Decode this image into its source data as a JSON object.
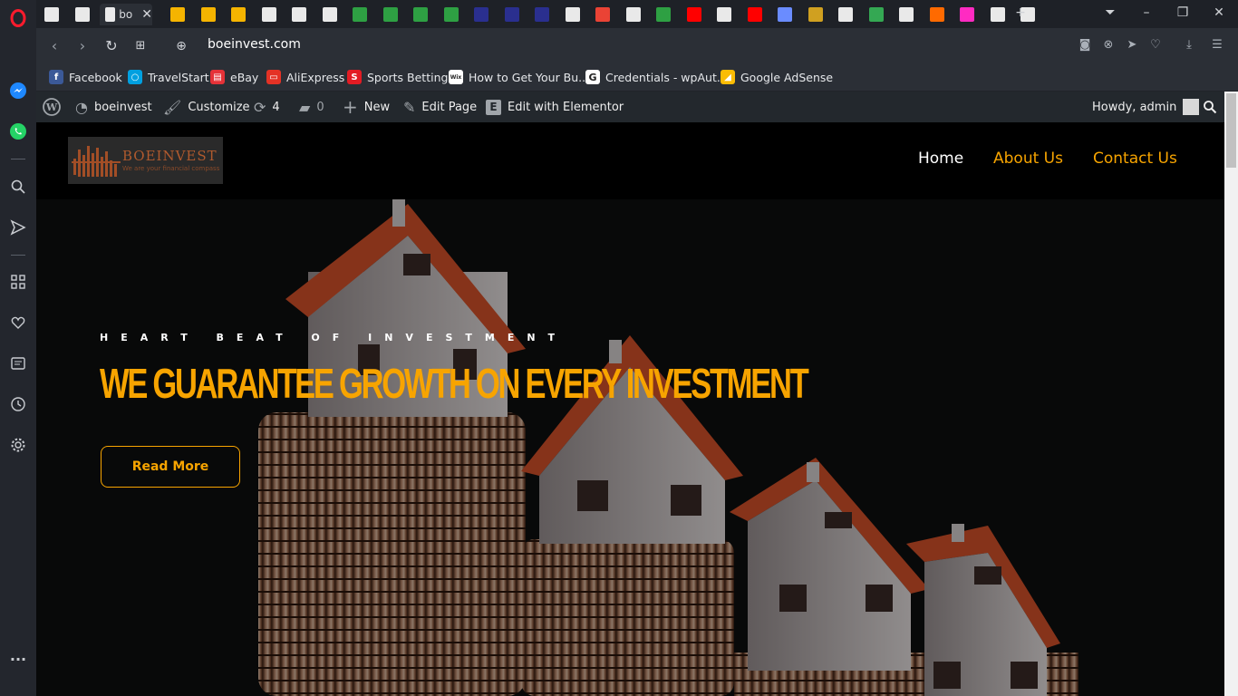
{
  "browser": {
    "active_tab_title": "bo",
    "url": "boeinvest.com",
    "tab_favicon_colors": [
      "#ffffff",
      "#ffffff",
      "#ffffff",
      "#f5b400",
      "#f5b400",
      "#f5b400",
      "#ffffff",
      "#ffffff",
      "#ffffff",
      "#2ea043",
      "#2ea043",
      "#2ea043",
      "#2ea043",
      "#2a2f8f",
      "#2a2f8f",
      "#2a2f8f",
      "#ffffff",
      "#ea4335",
      "#ffffff",
      "#2ea043",
      "#ff0000",
      "#ffffff",
      "#ff0000",
      "#6a8cff",
      "#d0a020",
      "#ffffff",
      "#34a853",
      "#ffffff",
      "#ff6a00",
      "#ff2bc2",
      "#ffffff",
      "#ffffff"
    ]
  },
  "bookmarks": [
    {
      "label": "Facebook",
      "icon": "facebook-icon",
      "color": "#3b5998",
      "glyph": "f"
    },
    {
      "label": "TravelStart",
      "icon": "travelstart-icon",
      "color": "#00a0e0",
      "glyph": "○"
    },
    {
      "label": "eBay",
      "icon": "ebay-icon",
      "color": "#e53238",
      "glyph": "▤"
    },
    {
      "label": "AliExpress",
      "icon": "aliexpress-icon",
      "color": "#e43225",
      "glyph": "▭"
    },
    {
      "label": "Sports Betting",
      "icon": "sportsbet-icon",
      "color": "#e31b23",
      "glyph": "S"
    },
    {
      "label": "How to Get Your Bu...",
      "icon": "wix-icon",
      "color": "#ffffff",
      "glyph": "Wix"
    },
    {
      "label": "Credentials - wpAut...",
      "icon": "google-icon",
      "color": "#ffffff",
      "glyph": "G"
    },
    {
      "label": "Google AdSense",
      "icon": "adsense-icon",
      "color": "#fbbc04",
      "glyph": "◢"
    }
  ],
  "wp_admin": {
    "site_name": "boeinvest",
    "customize": "Customize",
    "updates": "4",
    "comments": "0",
    "new": "New",
    "edit_page": "Edit Page",
    "edit_elementor": "Edit with Elementor",
    "howdy": "Howdy, admin"
  },
  "site": {
    "logo_text": "BOEINVEST",
    "logo_tagline": "We are your financial compass",
    "menu": [
      {
        "label": "Home",
        "color": "#ffffff"
      },
      {
        "label": "About Us",
        "color": "#f7a400"
      },
      {
        "label": "Contact Us",
        "color": "#f7a400"
      }
    ],
    "hero": {
      "subtitle": "HEART BEAT OF INVESTMENT",
      "headline": "WE GUARANTEE GROWTH ON EVERY INVESTMENT",
      "button": "Read More"
    }
  },
  "colors": {
    "accent": "#f7a400",
    "roof": "#d8532a"
  }
}
